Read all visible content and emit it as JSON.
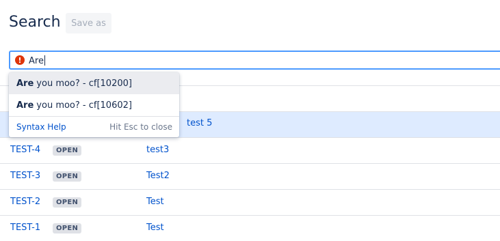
{
  "header": {
    "title": "Search",
    "save_as_label": "Save as"
  },
  "search": {
    "query": "Are",
    "error_icon": "error-icon",
    "error_color": "#de350b",
    "focus_color": "#4c9aff"
  },
  "dropdown": {
    "suggestions": [
      {
        "bold": "Are",
        "rest": "you moo? - cf[10200]"
      },
      {
        "bold": "Are",
        "rest": "you moo? - cf[10602]"
      }
    ],
    "syntax_help": "Syntax Help",
    "esc_hint": "Hit Esc to close"
  },
  "rows": [
    {
      "key": "",
      "status": "",
      "summary": "",
      "fragment": "y"
    },
    {
      "key": "",
      "status": "",
      "summary": "test 5",
      "fragment": "/"
    },
    {
      "key": "TEST-4",
      "status": "OPEN",
      "summary": "test3"
    },
    {
      "key": "TEST-3",
      "status": "OPEN",
      "summary": "Test2"
    },
    {
      "key": "TEST-2",
      "status": "OPEN",
      "summary": "Test"
    },
    {
      "key": "TEST-1",
      "status": "OPEN",
      "summary": "Test"
    }
  ],
  "colors": {
    "link": "#0052cc",
    "selected_row": "#deebff",
    "lozenge_bg": "#dfe1e6"
  }
}
